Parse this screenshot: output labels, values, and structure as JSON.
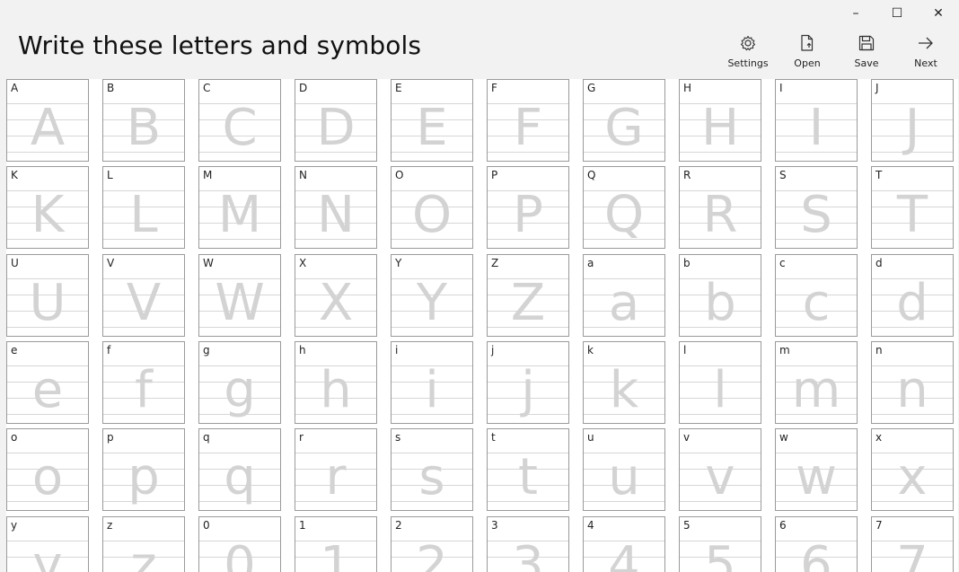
{
  "window": {
    "title": "Write these letters and symbols",
    "controls": [
      {
        "name": "minimize-icon",
        "glyph": "–"
      },
      {
        "name": "maximize-icon",
        "glyph": "☐"
      },
      {
        "name": "close-icon",
        "glyph": "✕"
      }
    ]
  },
  "toolbar": {
    "buttons": [
      {
        "id": "settings",
        "label": "Settings",
        "icon": "gear-icon"
      },
      {
        "id": "open",
        "label": "Open",
        "icon": "file-open-icon"
      },
      {
        "id": "save",
        "label": "Save",
        "icon": "save-icon"
      },
      {
        "id": "next",
        "label": "Next",
        "icon": "arrow-right-icon"
      }
    ]
  },
  "characters": [
    "A",
    "B",
    "C",
    "D",
    "E",
    "F",
    "G",
    "H",
    "I",
    "J",
    "K",
    "L",
    "M",
    "N",
    "O",
    "P",
    "Q",
    "R",
    "S",
    "T",
    "U",
    "V",
    "W",
    "X",
    "Y",
    "Z",
    "a",
    "b",
    "c",
    "d",
    "e",
    "f",
    "g",
    "h",
    "i",
    "j",
    "k",
    "l",
    "m",
    "n",
    "o",
    "p",
    "q",
    "r",
    "s",
    "t",
    "u",
    "v",
    "w",
    "x",
    "y",
    "z",
    "0",
    "1",
    "2",
    "3",
    "4",
    "5",
    "6",
    "7"
  ]
}
